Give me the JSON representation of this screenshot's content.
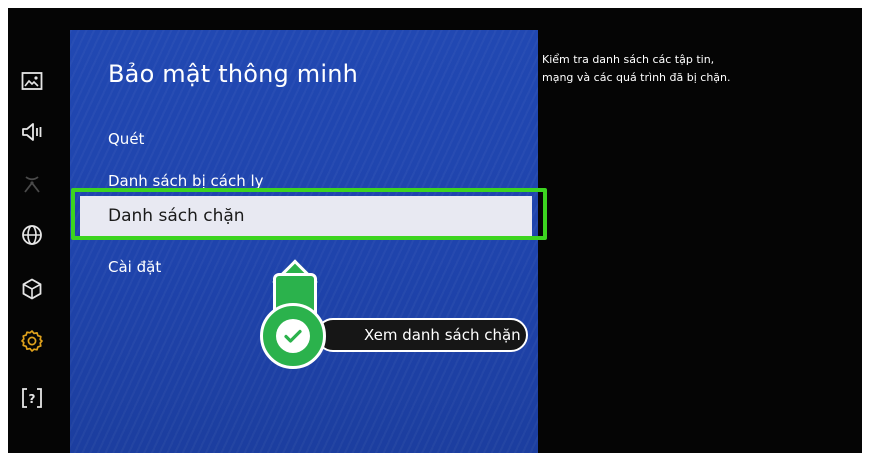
{
  "sidebar": {
    "items": [
      {
        "icon": "picture-icon",
        "active": false
      },
      {
        "icon": "sound-icon",
        "active": false
      },
      {
        "icon": "broadcast-icon",
        "active": false
      },
      {
        "icon": "network-icon",
        "active": false
      },
      {
        "icon": "smart-hub-icon",
        "active": false
      },
      {
        "icon": "settings-icon",
        "active": true
      },
      {
        "icon": "support-icon",
        "active": false
      }
    ],
    "accent_color": "#e0a21c"
  },
  "panel": {
    "title": "Bảo mật thông minh",
    "menu": [
      {
        "label": "Quét"
      },
      {
        "label": "Danh sách bị cách ly"
      },
      {
        "label": "Danh sách chặn",
        "selected": true
      },
      {
        "label": "Cài đặt"
      }
    ]
  },
  "description": "Kiểm tra danh sách các tập tin, mạng và các quá trình đã bị chặn.",
  "callout": {
    "label": "Xem danh sách chặn",
    "color": "#2bb24c",
    "icon": "checkmark-icon"
  },
  "highlight_color": "#3cd420"
}
